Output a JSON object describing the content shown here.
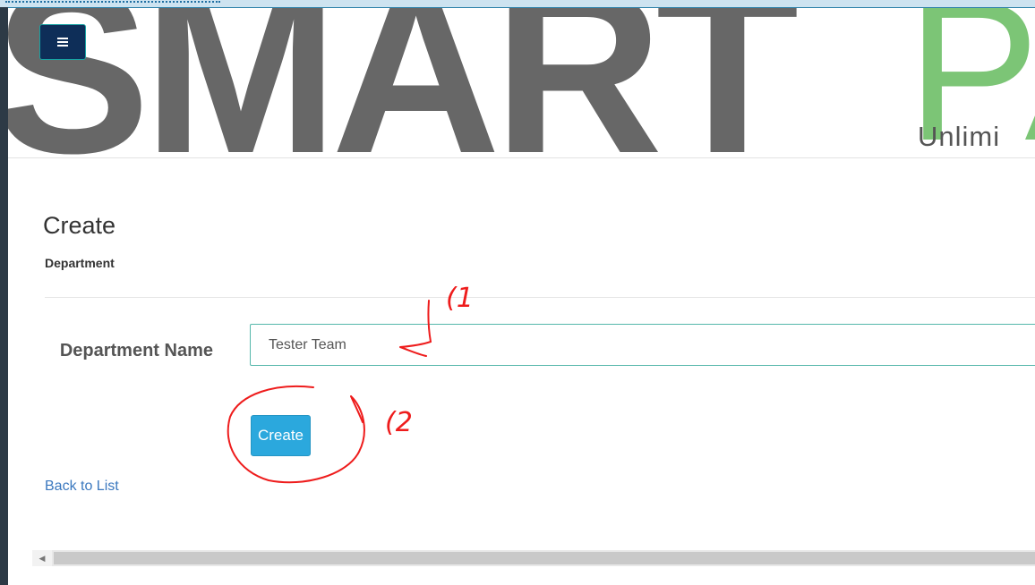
{
  "header": {
    "menu_icon": "hamburger-icon",
    "logo": {
      "word": "SMART",
      "trailing_letters": "PA",
      "subtitle": "Unlimi",
      "colors": {
        "smart": "#676767",
        "accent": "#7cc576"
      }
    }
  },
  "page": {
    "title": "Create",
    "subtitle": "Department"
  },
  "form": {
    "department_name_label": "Department Name",
    "department_name_value": "Tester Team",
    "submit_label": "Create"
  },
  "footer": {
    "back_link": "Back to List"
  },
  "annotations": {
    "step1": "(1",
    "step2": "(2",
    "color": "#ee1c1c"
  },
  "colors": {
    "button": "#2ba8dd",
    "menu_button": "#0e2e58",
    "link": "#3b78bf",
    "input_border": "#55b7ab"
  }
}
